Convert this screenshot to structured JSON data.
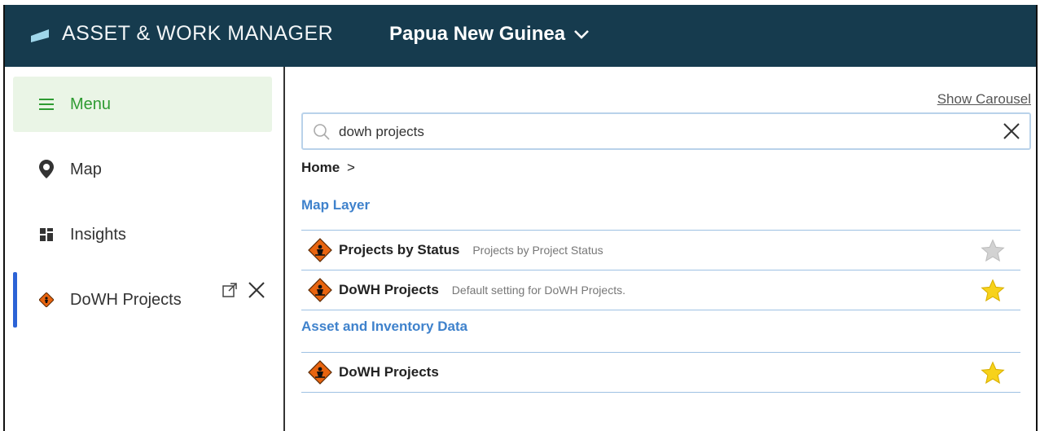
{
  "header": {
    "app_title": "ASSET & WORK MANAGER",
    "region": "Papua New Guinea",
    "colors": {
      "bar": "#163b4e",
      "logo": "#9fd6ea"
    }
  },
  "sidebar": {
    "items": [
      {
        "label": "Menu",
        "icon": "hamburger-icon",
        "active_style": "green"
      },
      {
        "label": "Map",
        "icon": "map-pin-icon"
      },
      {
        "label": "Insights",
        "icon": "dashboard-icon"
      },
      {
        "label": "DoWH Projects",
        "icon": "roadwork-sign-icon",
        "selected": true
      }
    ],
    "actions": [
      "open-external-icon",
      "close-icon"
    ]
  },
  "main": {
    "show_carousel": "Show Carousel",
    "search": {
      "value": "dowh projects",
      "placeholder": "Search"
    },
    "breadcrumb": {
      "home": "Home",
      "separator": ">"
    },
    "sections": [
      {
        "title": "Map Layer",
        "items": [
          {
            "name": "Projects by Status",
            "description": "Projects by Project Status",
            "favorite": false
          },
          {
            "name": "DoWH Projects",
            "description": "Default setting for DoWH Projects.",
            "favorite": true
          }
        ]
      },
      {
        "title": "Asset and Inventory Data",
        "items": [
          {
            "name": "DoWH Projects",
            "description": "",
            "favorite": true
          }
        ]
      }
    ]
  },
  "colors": {
    "section_title": "#3f82cc",
    "menu_green": "#2e9b32",
    "star_on": "#f7d21b",
    "star_off": "#c9c9c9",
    "roadwork_orange": "#e8640f"
  }
}
